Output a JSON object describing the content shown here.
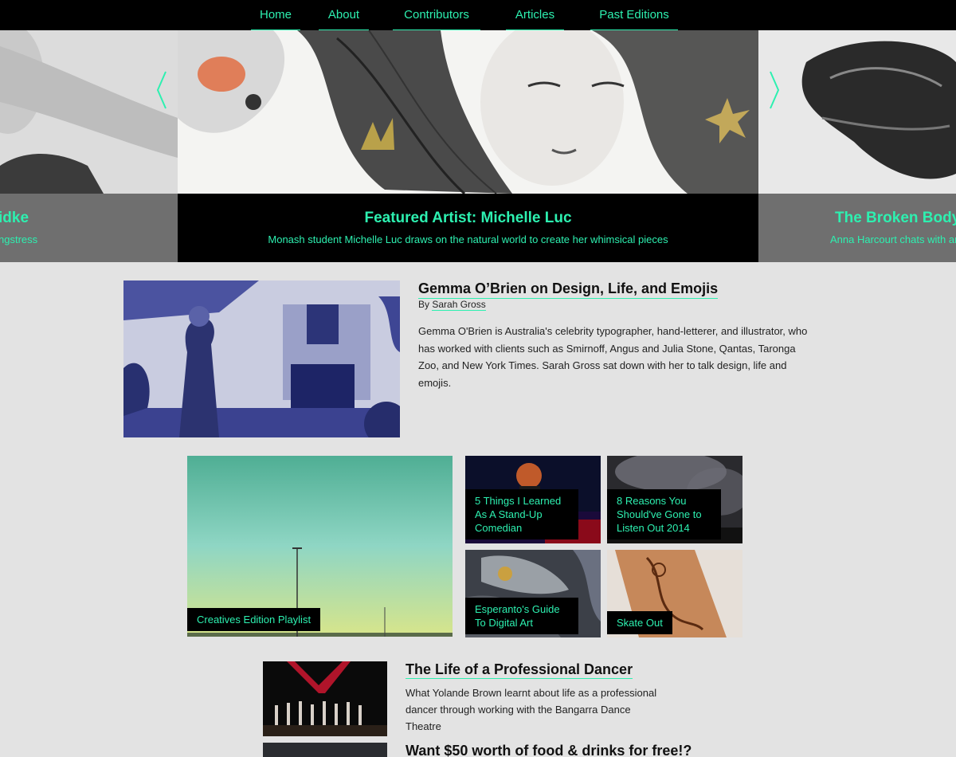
{
  "nav": {
    "items": [
      {
        "label": "Home"
      },
      {
        "label": "About"
      },
      {
        "label": "Contributors"
      },
      {
        "label": "Articles"
      },
      {
        "label": "Past Editions"
      }
    ]
  },
  "carousel": {
    "prev": {
      "title": "idke",
      "subtitle": "ngstress"
    },
    "current": {
      "title": "Featured Artist: Michelle Luc",
      "subtitle": "Monash student Michelle Luc draws on the natural world to create her whimsical pieces"
    },
    "next": {
      "title": "The Broken Body: I",
      "subtitle": "Anna Harcourt chats with art"
    },
    "accent": "#2df0b0"
  },
  "featured": {
    "title": "Gemma O’Brien on Design, Life, and Emojis",
    "by_prefix": "By",
    "author": "Sarah Gross",
    "body": "Gemma O'Brien is Australia's celebrity typographer, hand-letterer, and illustrator, who has worked with clients such as Smirnoff, Angus and Julia Stone, Qantas, Taronga Zoo, and New York Times. Sarah Gross sat down with her to talk design, life and emojis."
  },
  "grid": {
    "tiles": [
      {
        "label": "Creatives Edition Playlist"
      },
      {
        "label": "5 Things I Learned As A Stand-Up Comedian"
      },
      {
        "label": "8 Reasons You Should've Gone to Listen Out 2014"
      },
      {
        "label": "Esperanto's Guide To Digital Art"
      },
      {
        "label": "Skate Out"
      }
    ]
  },
  "list": {
    "items": [
      {
        "title": "The Life of a Professional Dancer",
        "body": "What Yolande Brown learnt about life as a professional dancer through working with the Bangarra Dance Theatre"
      },
      {
        "title": "Want $50 worth of food & drinks for free!?",
        "body": ""
      }
    ]
  }
}
